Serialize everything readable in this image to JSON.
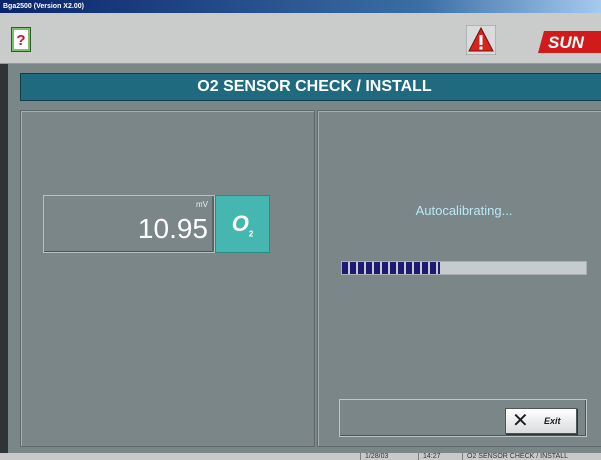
{
  "window": {
    "title": "Bga2500 (Version X2.00)"
  },
  "toolbar": {
    "help_icon": "help-question-icon",
    "warning_icon": "warning-triangle-icon",
    "logo_text": "SUN"
  },
  "page": {
    "title": "O2 SENSOR CHECK / INSTALL"
  },
  "readout": {
    "unit": "mV",
    "value": "10.95",
    "sensor_label": "O",
    "sensor_sub": "2"
  },
  "calibration": {
    "status": "Autocalibrating...",
    "progress_percent": 40
  },
  "exit": {
    "label": "Exit",
    "icon": "close-x-icon"
  },
  "statusbar": {
    "date": "1/28/03",
    "time": "14:27",
    "screen": "O2 SENSOR CHECK / INSTALL"
  },
  "colors": {
    "banner": "#1f6a7f",
    "o2_badge": "#46b6b0",
    "progress": "#1e1a72",
    "status_text": "#b9e8f4"
  }
}
